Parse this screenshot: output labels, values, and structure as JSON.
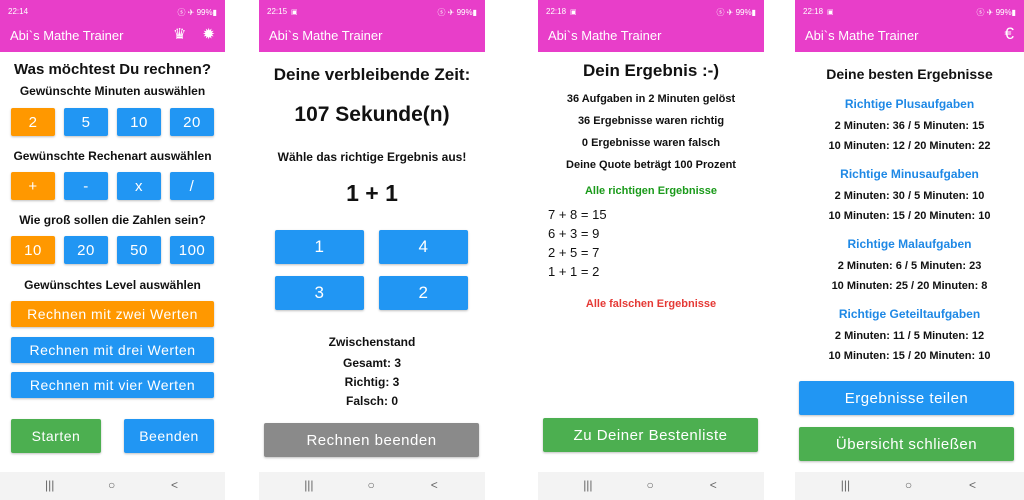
{
  "status": {
    "time1": "22:14",
    "time2": "22:15",
    "time3": "22:18",
    "time4": "22:18",
    "indicators": "ⓢ ✈ 99%▮"
  },
  "app": {
    "title": "Abi`s Mathe Trainer"
  },
  "icons": {
    "crown": "♛",
    "gear": "✹",
    "euro": "€",
    "image": "▣"
  },
  "nav": {
    "recents": "|||",
    "home": "○",
    "back": "<"
  },
  "colors": {
    "accent": "#e83ec9",
    "blue": "#2196f3",
    "orange": "#ff9800",
    "green": "#4caf50",
    "grey": "#8a8a8a",
    "correct": "#1a9a1a",
    "wrong": "#e53935",
    "link": "#1e88e5"
  },
  "screen1": {
    "question": "Was möchtest Du rechnen?",
    "minutes_label": "Gewünschte Minuten auswählen",
    "minutes": [
      "2",
      "5",
      "10",
      "20"
    ],
    "operation_label": "Gewünschte Rechenart auswählen",
    "operations": [
      "+",
      "-",
      "x",
      "/"
    ],
    "size_label": "Wie groß sollen die Zahlen sein?",
    "sizes": [
      "10",
      "20",
      "50",
      "100"
    ],
    "level_label": "Gewünschtes Level auswählen",
    "levels": [
      "Rechnen mit zwei Werten",
      "Rechnen mit drei Werten",
      "Rechnen mit vier Werten"
    ],
    "start": "Starten",
    "end": "Beenden"
  },
  "screen2": {
    "time_label": "Deine verbleibende Zeit:",
    "seconds": "107 Sekunde(n)",
    "instruction": "Wähle das richtige Ergebnis aus!",
    "task": "1 + 1",
    "answers": [
      "1",
      "4",
      "3",
      "2"
    ],
    "score_title": "Zwischenstand",
    "total": "Gesamt: 3",
    "correct": "Richtig: 3",
    "wrong": "Falsch: 0",
    "finish": "Rechnen beenden"
  },
  "screen3": {
    "title": "Dein Ergebnis :-)",
    "lines": [
      "36 Aufgaben in 2 Minuten gelöst",
      "36 Ergebnisse waren richtig",
      "0 Ergebnisse waren falsch",
      "Deine Quote beträgt 100 Prozent"
    ],
    "correct_title": "Alle richtigen Ergebnisse",
    "equations": [
      "7 + 8 = 15",
      "6 + 3 = 9",
      "2 + 5 = 7",
      "1 + 1 = 2"
    ],
    "wrong_title": "Alle falschen Ergebnisse",
    "to_leaderboard": "Zu Deiner Bestenliste"
  },
  "screen4": {
    "title": "Deine besten Ergebnisse",
    "sections": [
      {
        "title": "Richtige Plusaufgaben",
        "row1": "2 Minuten: 36  /  5 Minuten: 15",
        "row2": "10 Minuten: 12  /  20 Minuten: 22"
      },
      {
        "title": "Richtige Minusaufgaben",
        "row1": "2 Minuten: 30  /  5 Minuten: 10",
        "row2": "10 Minuten: 15  /  20 Minuten: 10"
      },
      {
        "title": "Richtige Malaufgaben",
        "row1": "2 Minuten: 6  /  5 Minuten: 23",
        "row2": "10 Minuten: 25  /  20 Minuten: 8"
      },
      {
        "title": "Richtige Geteiltaufgaben",
        "row1": "2 Minuten: 11  /  5 Minuten: 12",
        "row2": "10 Minuten: 15  /  20 Minuten: 10"
      }
    ],
    "share": "Ergebnisse teilen",
    "close": "Übersicht schließen"
  }
}
